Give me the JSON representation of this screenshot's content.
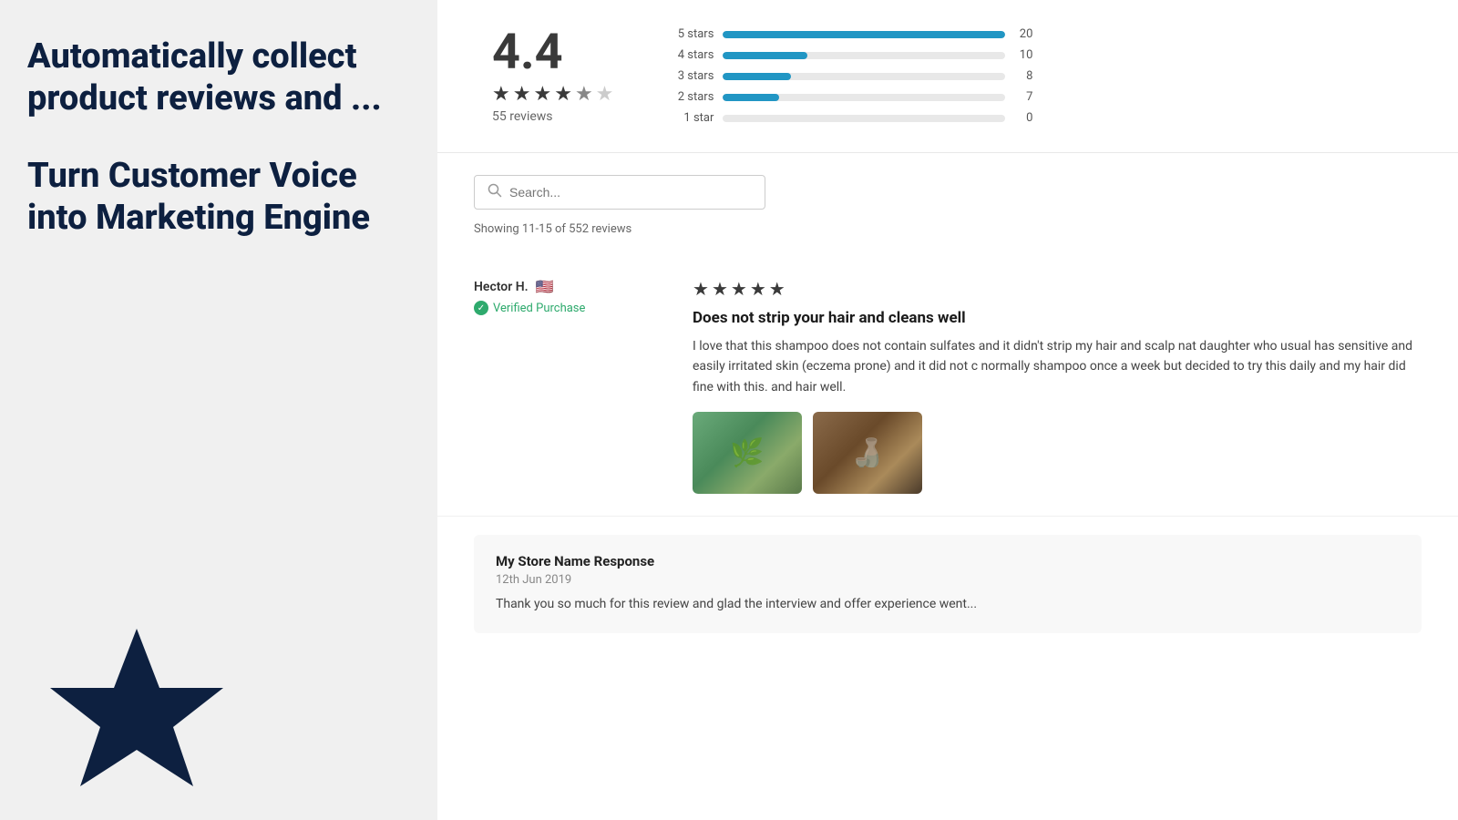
{
  "left": {
    "heading1": "Automatically collect product reviews and ...",
    "heading2": "Turn Customer Voice into Marketing Engine"
  },
  "rating": {
    "score": "4.4",
    "review_count": "55 reviews",
    "stars": [
      {
        "type": "filled"
      },
      {
        "type": "filled"
      },
      {
        "type": "filled"
      },
      {
        "type": "filled"
      },
      {
        "type": "half"
      }
    ],
    "bars": [
      {
        "label": "5 stars",
        "count": 20,
        "max": 20,
        "pct": 100
      },
      {
        "label": "4 stars",
        "count": 10,
        "max": 20,
        "pct": 30
      },
      {
        "label": "3 stars",
        "count": 8,
        "max": 20,
        "pct": 24
      },
      {
        "label": "2 stars",
        "count": 7,
        "max": 20,
        "pct": 20
      },
      {
        "label": "1 star",
        "count": 0,
        "max": 20,
        "pct": 0
      }
    ]
  },
  "search": {
    "placeholder": "Search...",
    "showing_text": "Showing 11-15 of 552 reviews"
  },
  "reviews": [
    {
      "reviewer": "Hector H.",
      "flag": "🇺🇸",
      "verified": "Verified Purchase",
      "stars": 5,
      "title": "Does not strip your hair and cleans well",
      "body": "I love that this shampoo does not contain sulfates and it didn't strip my hair and scalp nat daughter who usual has sensitive and easily irritated skin (eczema prone) and it did not c normally shampoo once a week but decided to try this daily and my hair did fine with this. and hair well.",
      "images": [
        "green",
        "brown"
      ]
    }
  ],
  "store_response": {
    "title": "My Store Name Response",
    "date": "12th Jun 2019",
    "body": "Thank you so much for this review and glad the interview and offer experience went..."
  },
  "colors": {
    "accent": "#2196c4",
    "dark_navy": "#0d2040",
    "green": "#2eaa6d"
  }
}
